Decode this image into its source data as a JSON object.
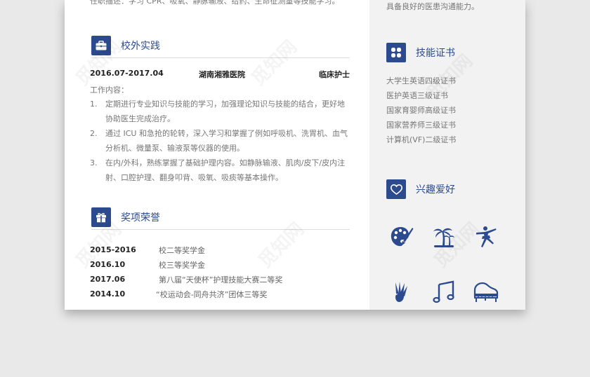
{
  "top_cut": {
    "left_text": "任职描述：学习 CPR、吸氧、静脉输液、给药、生命征测量等技能学习。",
    "right_text": "具备良好的医患沟通能力。"
  },
  "practice": {
    "title": "校外实践",
    "icon": "briefcase-icon",
    "date_range": "2016.07-2017.04",
    "org": "湖南湘雅医院",
    "role": "临床护士",
    "work_label": "工作内容：",
    "duties": [
      {
        "num": "1.",
        "text": "定期进行专业知识与技能的学习，加强理论知识与技能的结合，更好地协助医生完成治疗。"
      },
      {
        "num": "2.",
        "text": "通过 ICU 和急抢的轮转，深入学习和掌握了例如呼吸机、洗胃机、血气分析机、微量泵、输液泵等仪器的使用。"
      },
      {
        "num": "3.",
        "text": "在内/外科，熟练掌握了基础护理内容。如静脉输液、肌肉/皮下/皮内注射、口腔护理、翻身叩背、吸氧、吸痰等基本操作。"
      }
    ]
  },
  "awards": {
    "title": "奖项荣誉",
    "icon": "gift-icon",
    "items": [
      {
        "date": "2015-2016",
        "name": "校二等奖学金"
      },
      {
        "date": "2016.10",
        "name": "校三等奖学金"
      },
      {
        "date": "2017.06",
        "name": "第八届“天使杯”护理技能大赛二等奖"
      },
      {
        "date": "2014.10",
        "name": "“校运动会-同舟共济”团体三等奖"
      }
    ]
  },
  "certificates": {
    "title": "技能证书",
    "icon": "grid-icon",
    "items": [
      "大学生英语四级证书",
      "医护英语三级证书",
      "国家育婴师高级证书",
      "国家营养师三级证书",
      "计算机(VF)二级证书"
    ]
  },
  "hobbies": {
    "title": "兴趣爱好",
    "icon": "heart-icon",
    "items": [
      "painting-palette-icon",
      "palm-tree-icon",
      "dancer-icon",
      "badminton-icon",
      "music-note-icon",
      "piano-icon"
    ]
  },
  "watermark": "觅知网",
  "colors": {
    "accent": "#2c4a8e",
    "sidebar_bg": "#f2f2f2",
    "page_bg": "#e9e9e9"
  }
}
